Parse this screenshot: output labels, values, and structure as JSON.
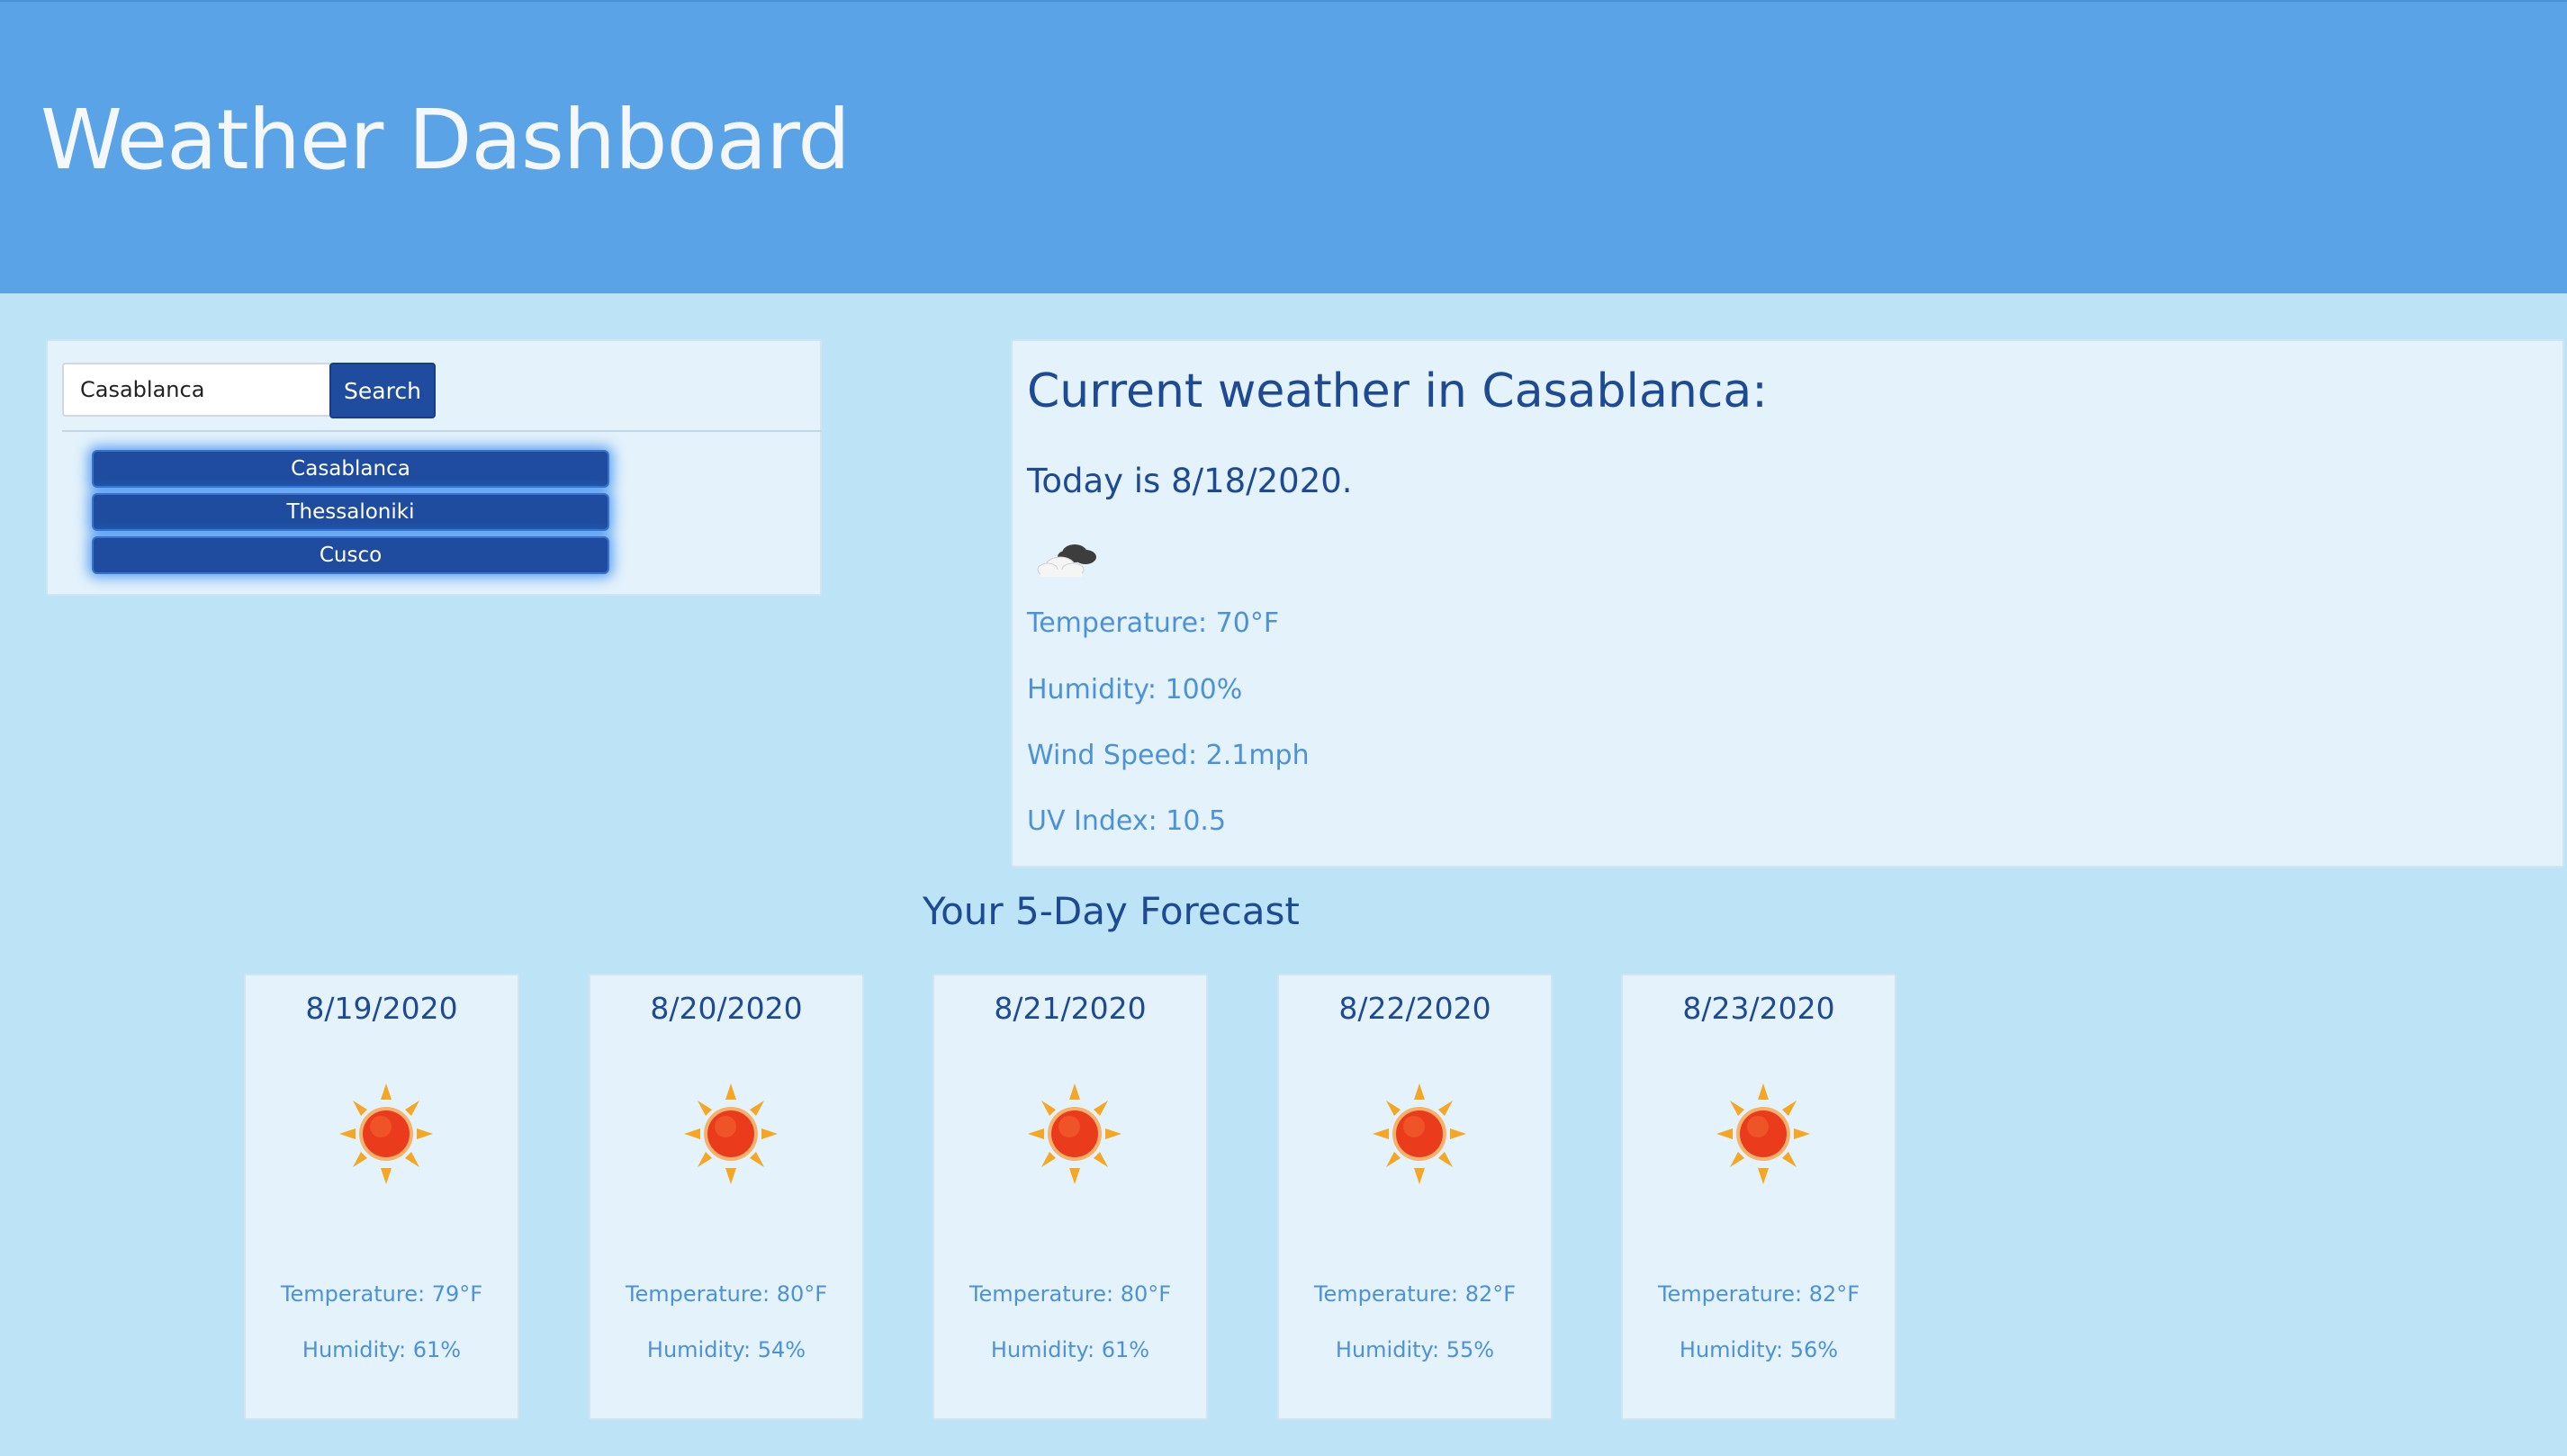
{
  "header": {
    "title": "Weather Dashboard"
  },
  "search": {
    "input_value": "Casablanca",
    "button_label": "Search",
    "history": [
      "Casablanca",
      "Thessaloniki",
      "Cusco"
    ]
  },
  "current": {
    "heading": "Current weather in Casablanca:",
    "today": "Today is 8/18/2020.",
    "icon": "cloud-icon",
    "temperature": "Temperature: 70°F",
    "humidity": "Humidity: 100%",
    "wind": "Wind Speed: 2.1mph",
    "uv": "UV Index: 10.5"
  },
  "forecast": {
    "title": "Your 5-Day Forecast",
    "days": [
      {
        "date": "8/19/2020",
        "icon": "sun-icon",
        "temperature": "Temperature: 79°F",
        "humidity": "Humidity: 61%"
      },
      {
        "date": "8/20/2020",
        "icon": "sun-icon",
        "temperature": "Temperature: 80°F",
        "humidity": "Humidity: 54%"
      },
      {
        "date": "8/21/2020",
        "icon": "sun-icon",
        "temperature": "Temperature: 80°F",
        "humidity": "Humidity: 61%"
      },
      {
        "date": "8/22/2020",
        "icon": "sun-icon",
        "temperature": "Temperature: 82°F",
        "humidity": "Humidity: 55%"
      },
      {
        "date": "8/23/2020",
        "icon": "sun-icon",
        "temperature": "Temperature: 82°F",
        "humidity": "Humidity: 56%"
      }
    ]
  },
  "colors": {
    "header_bg": "#59a3e6",
    "page_bg": "#bde3f7",
    "panel_bg": "#e3f2fb",
    "button_bg": "#1f4c9e",
    "heading_text": "#1e4a94",
    "stat_text": "#4d92d6"
  }
}
